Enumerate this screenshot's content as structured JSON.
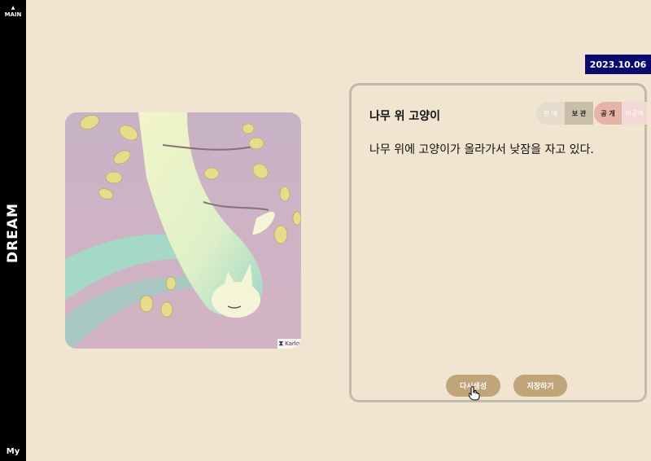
{
  "sidebar": {
    "main_label": "MAIN",
    "dream_label": "DREAM",
    "my_label": "My"
  },
  "date": "2023.10.06",
  "image": {
    "watermark": "Karlo",
    "icon": "tree-cat-illustration"
  },
  "card": {
    "title": "나무 위 고양이",
    "sell_toggle": {
      "sell": "판 매",
      "keep": "보 관"
    },
    "visibility_toggle": {
      "public": "공 개",
      "private": "비공개"
    },
    "text": "나무 위에 고양이가 올라가서 낮잠을 자고 있다.",
    "regenerate_label": "다시생성",
    "save_label": "저장하기"
  },
  "colors": {
    "background": "#f1e4d1",
    "sidebar": "#000000",
    "date_badge": "#0a0a6e",
    "button": "#bfa578"
  }
}
